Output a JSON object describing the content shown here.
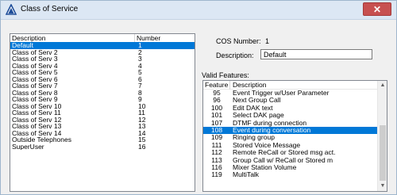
{
  "window": {
    "title": "Class of Service",
    "close_glyph": "✕"
  },
  "cos_list": {
    "headers": {
      "description": "Description",
      "number": "Number"
    },
    "rows": [
      {
        "description": "Default",
        "number": "1"
      },
      {
        "description": "Class of Serv 2",
        "number": "2"
      },
      {
        "description": "Class of Serv 3",
        "number": "3"
      },
      {
        "description": "Class of Serv 4",
        "number": "4"
      },
      {
        "description": "Class of Serv 5",
        "number": "5"
      },
      {
        "description": "Class of Serv 6",
        "number": "6"
      },
      {
        "description": "Class of Serv 7",
        "number": "7"
      },
      {
        "description": "Class of Serv 8",
        "number": "8"
      },
      {
        "description": "Class of Serv 9",
        "number": "9"
      },
      {
        "description": "Class of Serv 10",
        "number": "10"
      },
      {
        "description": "Class of Serv 11",
        "number": "11"
      },
      {
        "description": "Class of Serv 12",
        "number": "12"
      },
      {
        "description": "Class of Serv 13",
        "number": "13"
      },
      {
        "description": "Class of Serv 14",
        "number": "14"
      },
      {
        "description": "Outside Telephones",
        "number": "15"
      },
      {
        "description": "SuperUser",
        "number": "16"
      }
    ],
    "selected_index": 0
  },
  "details": {
    "cos_number_label": "COS Number:",
    "cos_number_value": "1",
    "description_label": "Description:",
    "description_value": "Default",
    "valid_features_label": "Valid Features:"
  },
  "features": {
    "headers": {
      "feature": "Feature",
      "description": "Description"
    },
    "rows": [
      {
        "feature": "95",
        "description": "Event Trigger w/User Parameter"
      },
      {
        "feature": "96",
        "description": "Next Group Call"
      },
      {
        "feature": "100",
        "description": "Edit DAK text"
      },
      {
        "feature": "101",
        "description": "Select DAK page"
      },
      {
        "feature": "107",
        "description": "DTMF during connection"
      },
      {
        "feature": "108",
        "description": "Event during conversation"
      },
      {
        "feature": "109",
        "description": "Ringing group"
      },
      {
        "feature": "111",
        "description": "Stored Voice Message"
      },
      {
        "feature": "112",
        "description": "Remote ReCall or Stored msg act."
      },
      {
        "feature": "113",
        "description": "Group Call w/ ReCall or Stored m"
      },
      {
        "feature": "116",
        "description": "Mixer Station Volume"
      },
      {
        "feature": "119",
        "description": "MultiTalk"
      }
    ],
    "selected_index": 5
  },
  "colors": {
    "selection": "#0078d7",
    "titlebar": "#dce7f4",
    "close_button": "#c75050"
  },
  "icons": {
    "title_icon": "delta-triangle-icon",
    "scroll_up": "scroll-up-arrow-icon",
    "scroll_down": "scroll-down-arrow-icon"
  }
}
